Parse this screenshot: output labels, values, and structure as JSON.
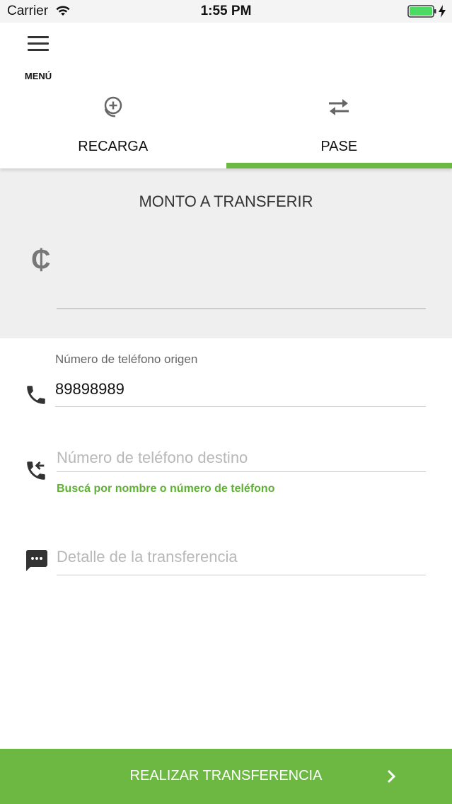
{
  "status_bar": {
    "carrier": "Carrier",
    "time": "1:55 PM"
  },
  "header": {
    "menu_label": "MENÚ"
  },
  "tabs": [
    {
      "label": "RECARGA",
      "icon": "add-money-icon",
      "selected": false
    },
    {
      "label": "PASE",
      "icon": "transfer-arrows-icon",
      "selected": true
    }
  ],
  "amount": {
    "title": "MONTO A TRANSFERIR",
    "currency_symbol": "₵",
    "value": ""
  },
  "origin_phone": {
    "label": "Número de teléfono origen",
    "value": "89898989"
  },
  "destination_phone": {
    "placeholder": "Número de teléfono destino",
    "helper": "Buscá por nombre o número de teléfono"
  },
  "detail": {
    "placeholder": "Detalle de la transferencia"
  },
  "submit": {
    "label": "REALIZAR TRANSFERENCIA"
  },
  "colors": {
    "accent": "#6cb843",
    "helper_text": "#5db233",
    "section_bg": "#efefef"
  }
}
